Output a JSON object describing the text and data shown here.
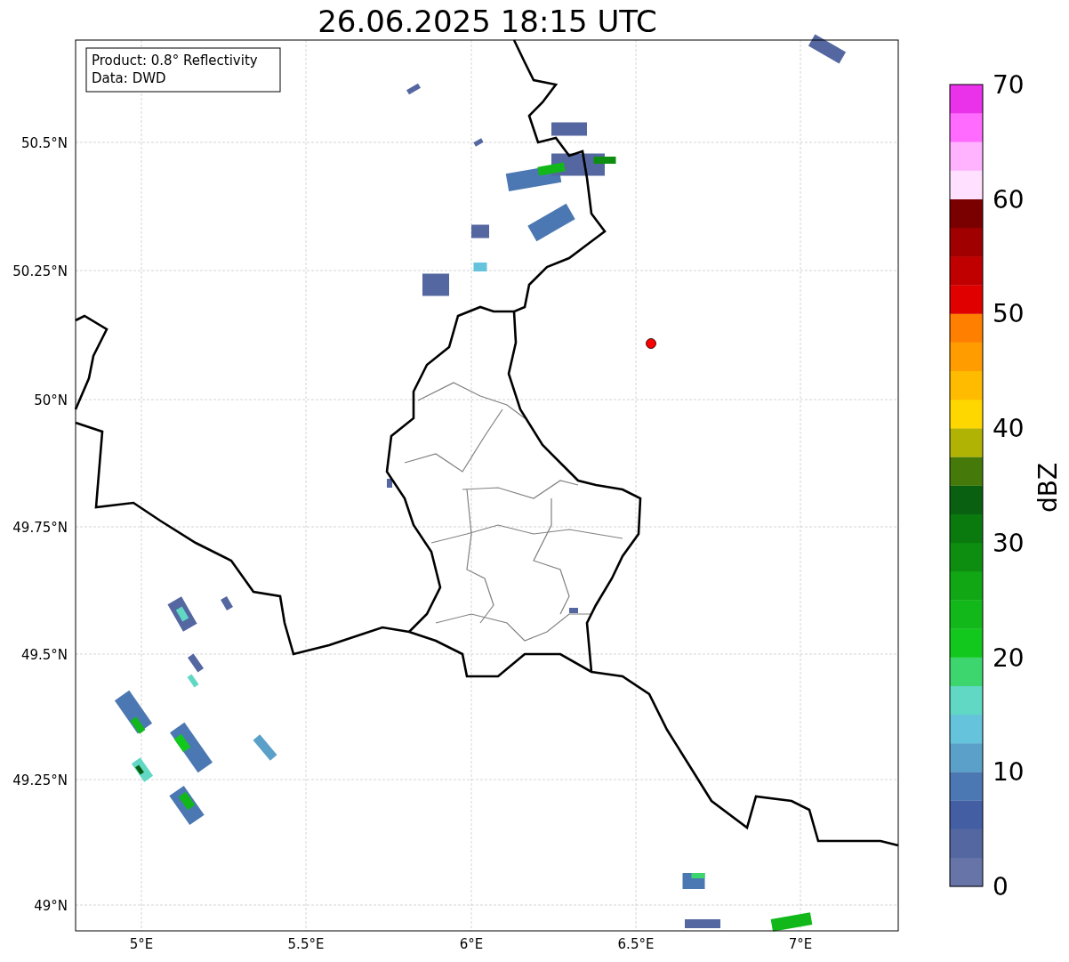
{
  "title": "26.06.2025 18:15 UTC",
  "info_box": [
    "Product: 0.8° Reflectivity",
    "Data: DWD"
  ],
  "yticks": [
    "50.5°N",
    "50.25°N",
    "50°N",
    "49.75°N",
    "49.5°N",
    "49.25°N",
    "49°N"
  ],
  "xticks": [
    "5°E",
    "5.5°E",
    "6°E",
    "6.5°E",
    "7°E"
  ],
  "colorbar": {
    "label": "dBZ",
    "ticks": [
      "70",
      "60",
      "50",
      "40",
      "30",
      "20",
      "10",
      "0"
    ],
    "segments": [
      {
        "color": "#6674a8"
      },
      {
        "color": "#5467a0"
      },
      {
        "color": "#435ea3"
      },
      {
        "color": "#4b78b2"
      },
      {
        "color": "#5aa0c8"
      },
      {
        "color": "#65c3dc"
      },
      {
        "color": "#60d8c4"
      },
      {
        "color": "#3dd66e"
      },
      {
        "color": "#12c81c"
      },
      {
        "color": "#12b81a"
      },
      {
        "color": "#10a614"
      },
      {
        "color": "#0d8e10"
      },
      {
        "color": "#0a7a0e"
      },
      {
        "color": "#086010"
      },
      {
        "color": "#457a0a"
      },
      {
        "color": "#b0b204"
      },
      {
        "color": "#ffd700"
      },
      {
        "color": "#ffbb00"
      },
      {
        "color": "#ff9c00"
      },
      {
        "color": "#ff7f00"
      },
      {
        "color": "#e00000"
      },
      {
        "color": "#c00000"
      },
      {
        "color": "#a00000"
      },
      {
        "color": "#7a0000"
      },
      {
        "color": "#ffe0ff"
      },
      {
        "color": "#ffb3ff"
      },
      {
        "color": "#ff6bff"
      },
      {
        "color": "#ea32ea"
      }
    ]
  }
}
